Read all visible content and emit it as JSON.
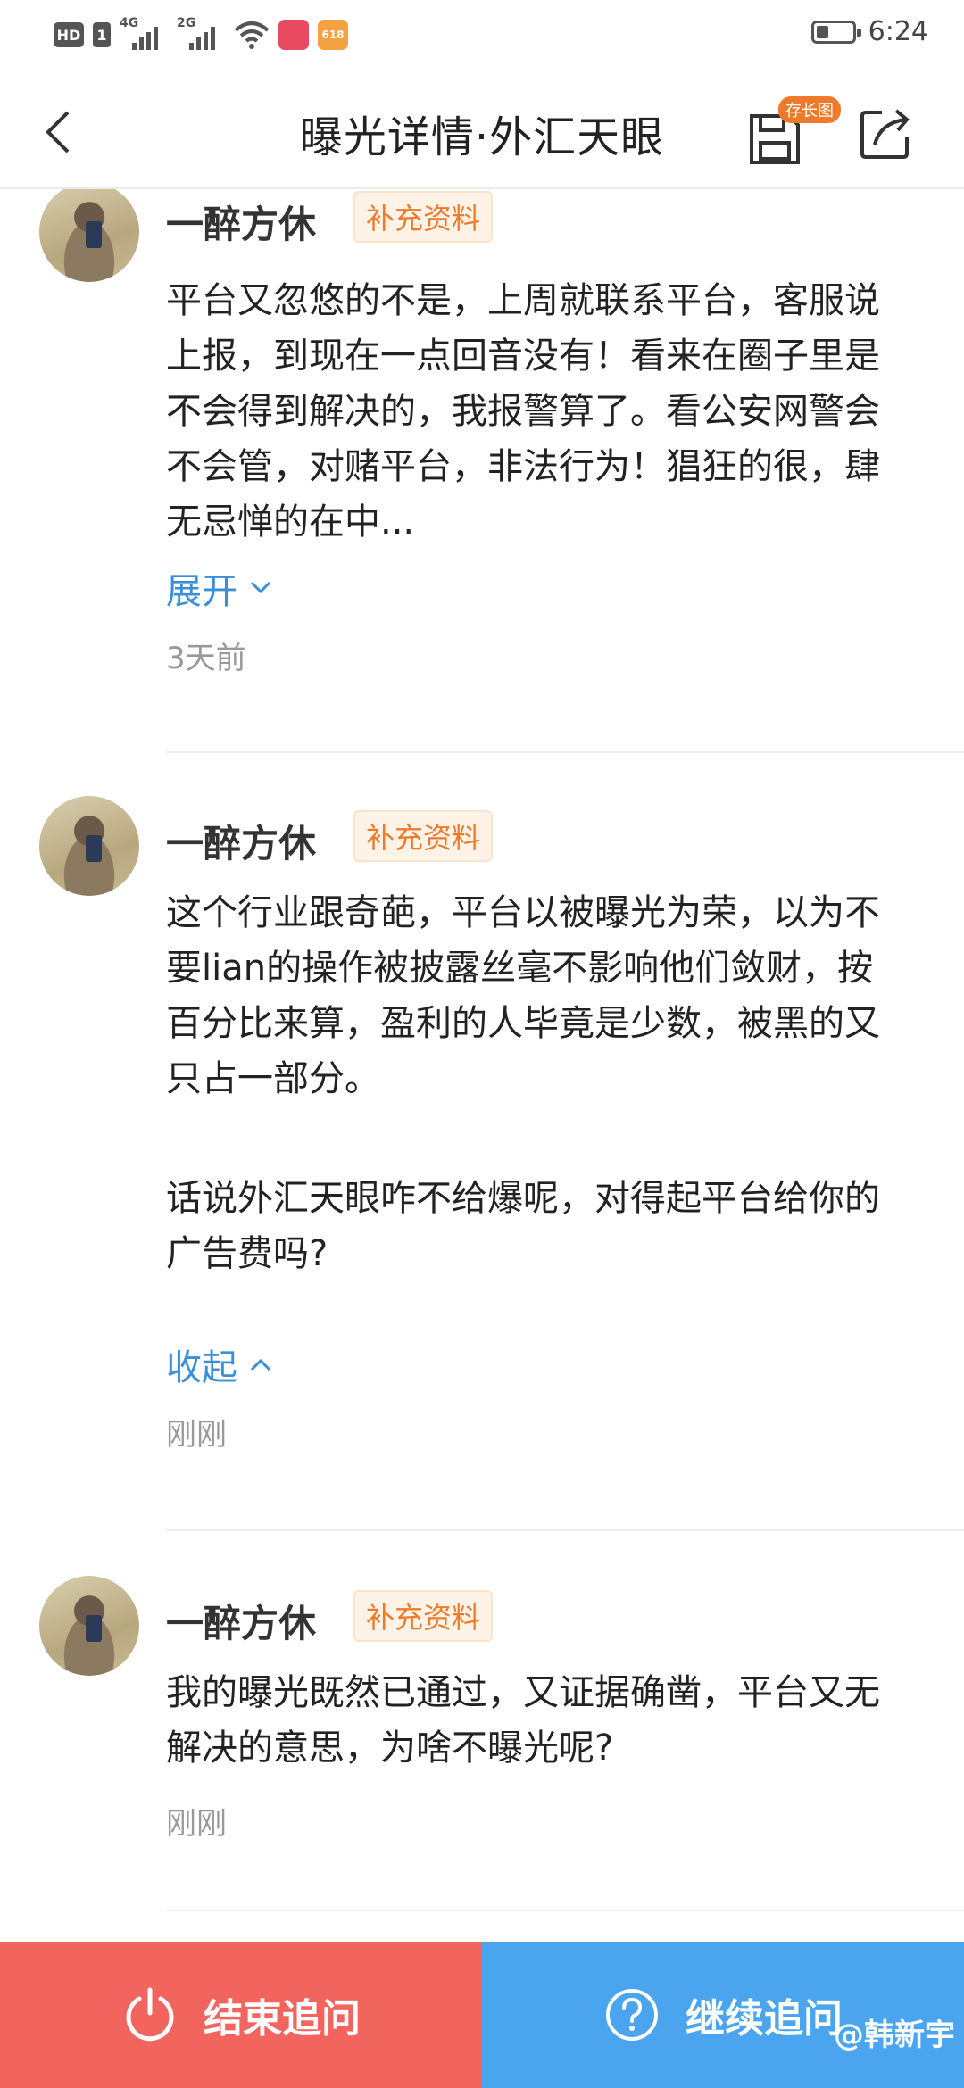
{
  "status_bar": {
    "hd_label": "HD",
    "sim_label": "1",
    "net1": "4G",
    "net2": "2G",
    "app_badge": "618",
    "battery_level": 0.35,
    "time": "6:24"
  },
  "header": {
    "title": "曝光详情·外汇天眼",
    "save_badge": "存长图"
  },
  "posts": [
    {
      "username": "一醉方休",
      "tag": "补充资料",
      "text": "平台又忽悠的不是，上周就联系平台，客服说上报，到现在一点回音没有！看来在圈子里是不会得到解决的，我报警算了。看公安网警会不会管，对赌平台，非法行为！猖狂的很，肆无忌惮的在中...",
      "toggle": "展开",
      "time": "3天前"
    },
    {
      "username": "一醉方休",
      "tag": "补充资料",
      "text_p1": "这个行业跟奇葩，平台以被曝光为荣，以为不要lian的操作被披露丝毫不影响他们敛财，按百分比来算，盈利的人毕竟是少数，被黑的又只占一部分。",
      "text_p2": "话说外汇天眼咋不给爆呢，对得起平台给你的广告费吗?",
      "toggle": "收起",
      "time": "刚刚"
    },
    {
      "username": "一醉方休",
      "tag": "补充资料",
      "text": "我的曝光既然已通过，又证据确凿，平台又无解决的意思，为啥不曝光呢?",
      "time": "刚刚"
    }
  ],
  "actions": {
    "end_label": "结束追问",
    "continue_label": "继续追问"
  },
  "watermark": "@韩新宇",
  "colors": {
    "tag_orange": "#ee7b2c",
    "link_blue": "#3b8fd9",
    "end_red": "#f2655f",
    "continue_blue": "#4aa5ee"
  }
}
